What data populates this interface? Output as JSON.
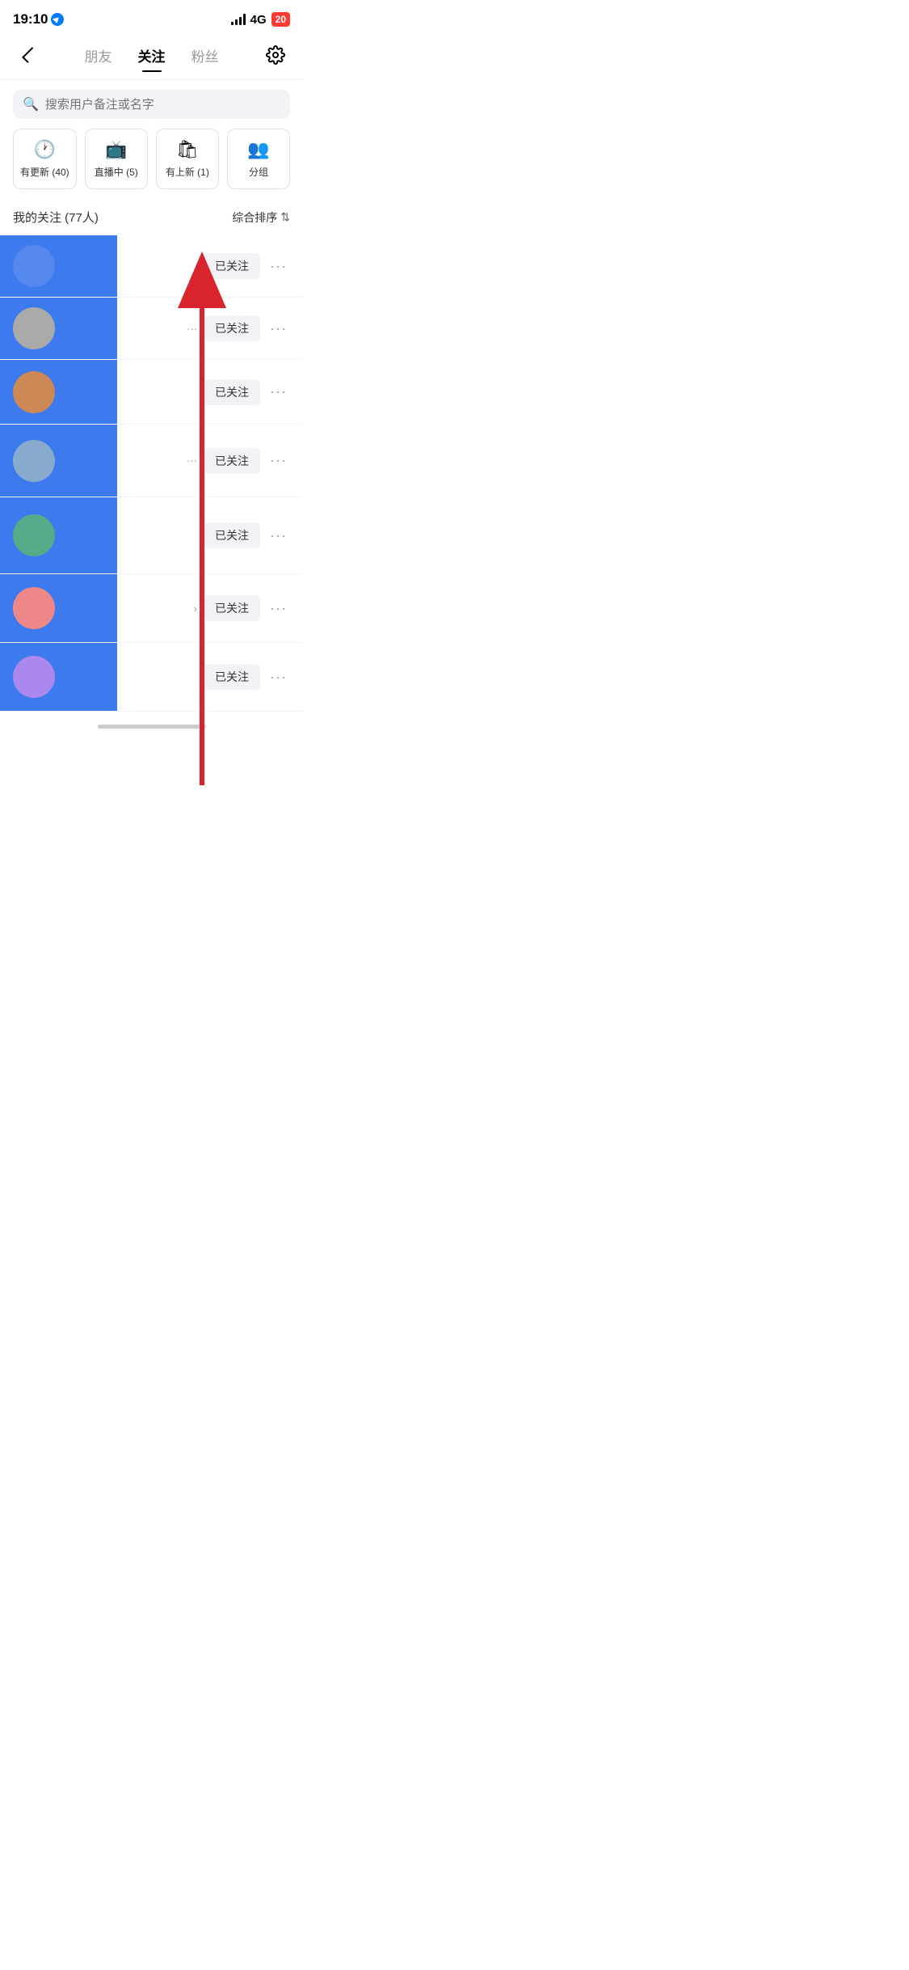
{
  "statusBar": {
    "time": "19:10",
    "network": "4G",
    "battery": "20"
  },
  "nav": {
    "tabs": [
      {
        "id": "friends",
        "label": "朋友",
        "active": false
      },
      {
        "id": "following",
        "label": "关注",
        "active": true
      },
      {
        "id": "fans",
        "label": "粉丝",
        "active": false
      }
    ]
  },
  "search": {
    "placeholder": "搜索用户备注或名字"
  },
  "filterCards": [
    {
      "id": "updates",
      "icon": "🕐",
      "label": "有更新 (40)"
    },
    {
      "id": "live",
      "icon": "📺",
      "label": "直播中 (5)"
    },
    {
      "id": "newPost",
      "icon": "🛍",
      "label": "有上新 (1)"
    },
    {
      "id": "groups",
      "icon": "👥",
      "label": "分组"
    }
  ],
  "sectionTitle": "我的关注 (77人)",
  "sortLabel": "综合排序",
  "users": [
    {
      "id": 1,
      "name": "",
      "desc": "",
      "followed": true,
      "followLabel": "已关注"
    },
    {
      "id": 2,
      "name": "",
      "desc": "",
      "followed": true,
      "followLabel": "已关注"
    },
    {
      "id": 3,
      "name": "",
      "desc": "",
      "followed": true,
      "followLabel": "已关注"
    },
    {
      "id": 4,
      "name": "",
      "desc": "",
      "followed": true,
      "followLabel": "已关注"
    },
    {
      "id": 5,
      "name": "",
      "desc": "",
      "followed": true,
      "followLabel": "已关注"
    },
    {
      "id": 6,
      "name": "",
      "desc": "",
      "followed": true,
      "followLabel": "已关注"
    },
    {
      "id": 7,
      "name": "",
      "desc": "",
      "followed": true,
      "followLabel": "已关注"
    }
  ],
  "colors": {
    "blue": "#3d7aed",
    "arrowRed": "#d9232d"
  }
}
